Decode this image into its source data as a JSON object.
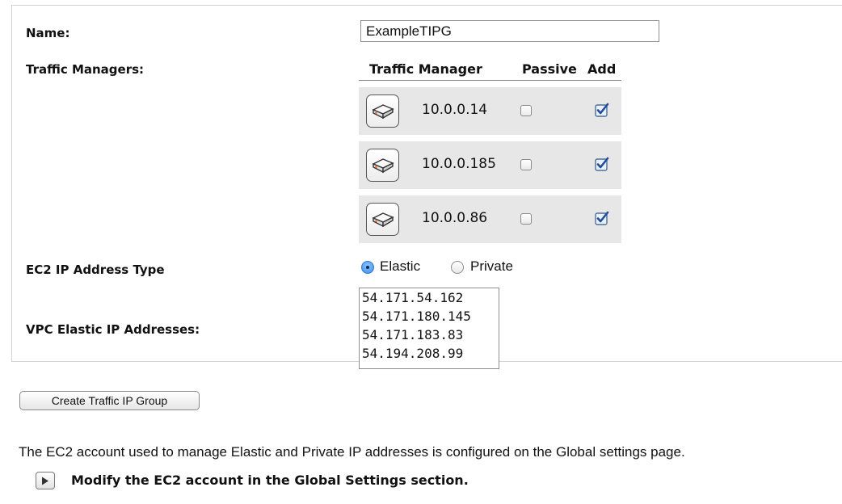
{
  "form": {
    "name_label": "Name:",
    "name_value": "ExampleTIPG",
    "traffic_managers_label": "Traffic Managers:",
    "ec2_ip_type_label": "EC2 IP Address Type",
    "vpc_elastic_label": "VPC Elastic IP Addresses:"
  },
  "traffic_managers": {
    "headers": {
      "traffic_manager": "Traffic Manager",
      "passive": "Passive",
      "add": "Add"
    },
    "rows": [
      {
        "ip": "10.0.0.14",
        "passive": false,
        "add": true,
        "icon": "server-appliance-icon"
      },
      {
        "ip": "10.0.0.185",
        "passive": false,
        "add": true,
        "icon": "server-appliance-icon"
      },
      {
        "ip": "10.0.0.86",
        "passive": false,
        "add": true,
        "icon": "server-appliance-icon"
      }
    ]
  },
  "ip_type": {
    "options": [
      "Elastic",
      "Private"
    ],
    "selected": "Elastic"
  },
  "elastic_ips": [
    "54.171.54.162",
    "54.171.180.145",
    "54.171.183.83",
    "54.194.208.99"
  ],
  "actions": {
    "create_button": "Create Traffic IP Group"
  },
  "footer": {
    "info": "The EC2 account used to manage Elastic and Private IP addresses is configured on the Global settings page.",
    "modify_link": "Modify the EC2 account in the Global Settings section."
  },
  "colors": {
    "row_bg": "#e7e7e7",
    "checkbox_check": "#1f4f9a",
    "radio_selected": "#3b8ee8"
  }
}
